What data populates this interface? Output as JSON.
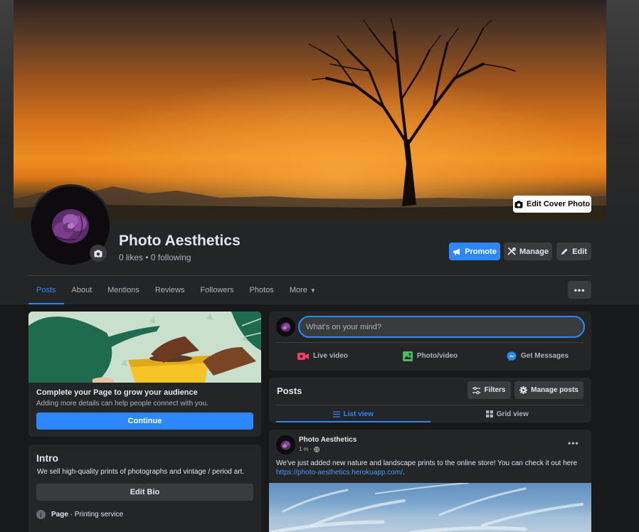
{
  "cover": {
    "edit_label": "Edit Cover Photo"
  },
  "page": {
    "title": "Photo Aesthetics",
    "stats": "0 likes • 0 following"
  },
  "actions": {
    "promote": "Promote",
    "manage": "Manage",
    "edit": "Edit"
  },
  "tabs": [
    {
      "label": "Posts"
    },
    {
      "label": "About"
    },
    {
      "label": "Mentions"
    },
    {
      "label": "Reviews"
    },
    {
      "label": "Followers"
    },
    {
      "label": "Photos"
    },
    {
      "label": "More"
    }
  ],
  "promo": {
    "title": "Complete your Page to grow your audience",
    "subtitle": "Adding more details can help people connect with you.",
    "button": "Continue"
  },
  "intro": {
    "title": "Intro",
    "text": "We sell high-quality prints of photographs and vintage / period art.",
    "edit_bio": "Edit Bio",
    "category_label": "Page",
    "category_value": " · Printing service"
  },
  "composer": {
    "placeholder": "What's on your mind?",
    "actions": [
      "Live video",
      "Photo/video",
      "Get Messages"
    ]
  },
  "posts_header": {
    "title": "Posts",
    "filters": "Filters",
    "manage_posts": "Manage posts",
    "list_view": "List view",
    "grid_view": "Grid view"
  },
  "post": {
    "author": "Photo Aesthetics",
    "time": "1 m ·",
    "text": "We've just added new nature and landscape prints to the online store! You can check it out here ",
    "link": "https://photo-aesthetics.herokuapp.com/",
    "text_end": "."
  },
  "colors": {
    "accent": "#2d88ff",
    "background": "#18191a",
    "card": "#242526",
    "button": "#3a3b3c"
  }
}
